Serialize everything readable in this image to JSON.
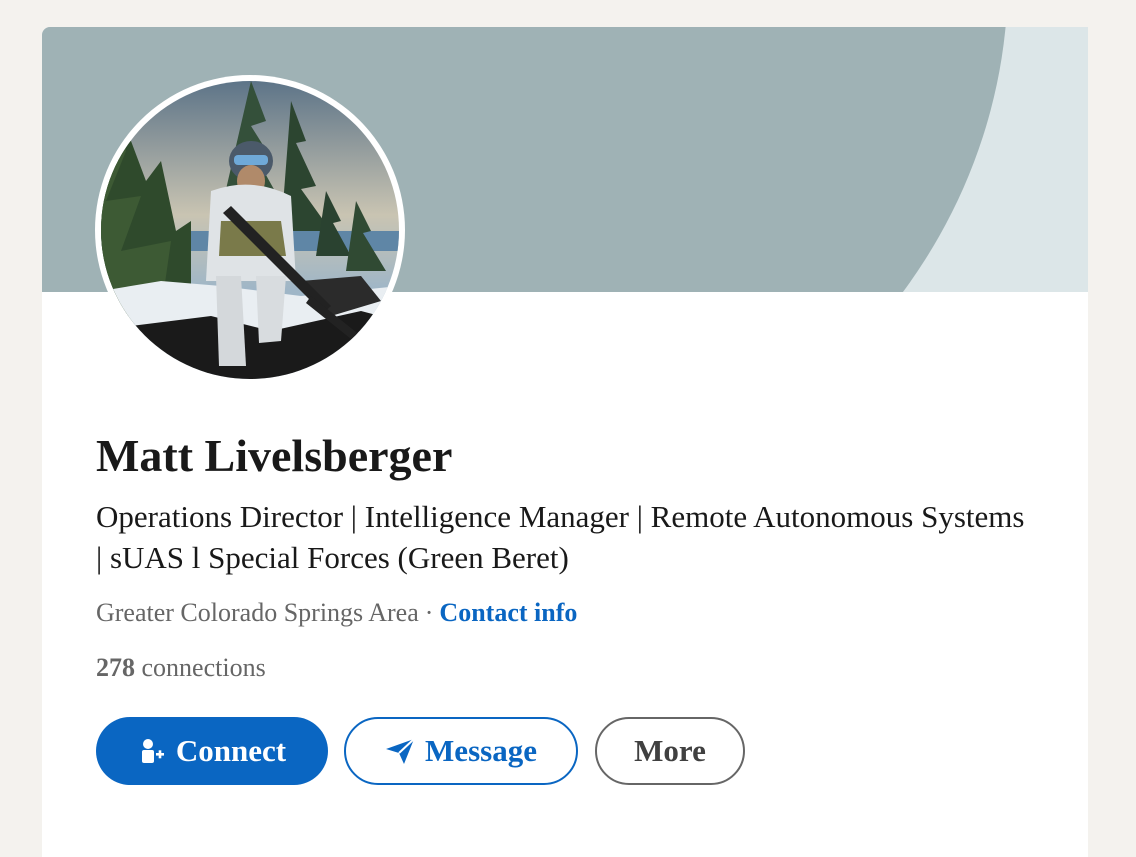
{
  "profile": {
    "name": "Matt Livelsberger",
    "headline": "Operations Director | Intelligence Manager | Remote Autonomous Systems | sUAS l Special Forces (Green Beret)",
    "location": "Greater Colorado Springs Area",
    "separator": "·",
    "contact_label": "Contact info",
    "connections_count": "278",
    "connections_label": "connections"
  },
  "actions": {
    "connect_label": "Connect",
    "message_label": "Message",
    "more_label": "More"
  },
  "icons": {
    "connect": "person-add-icon",
    "message": "paper-plane-icon"
  },
  "colors": {
    "brand": "#0a66c2",
    "banner": "#9fb2b5",
    "banner_light": "#dce6e8",
    "text": "#191919",
    "muted": "#666666"
  }
}
